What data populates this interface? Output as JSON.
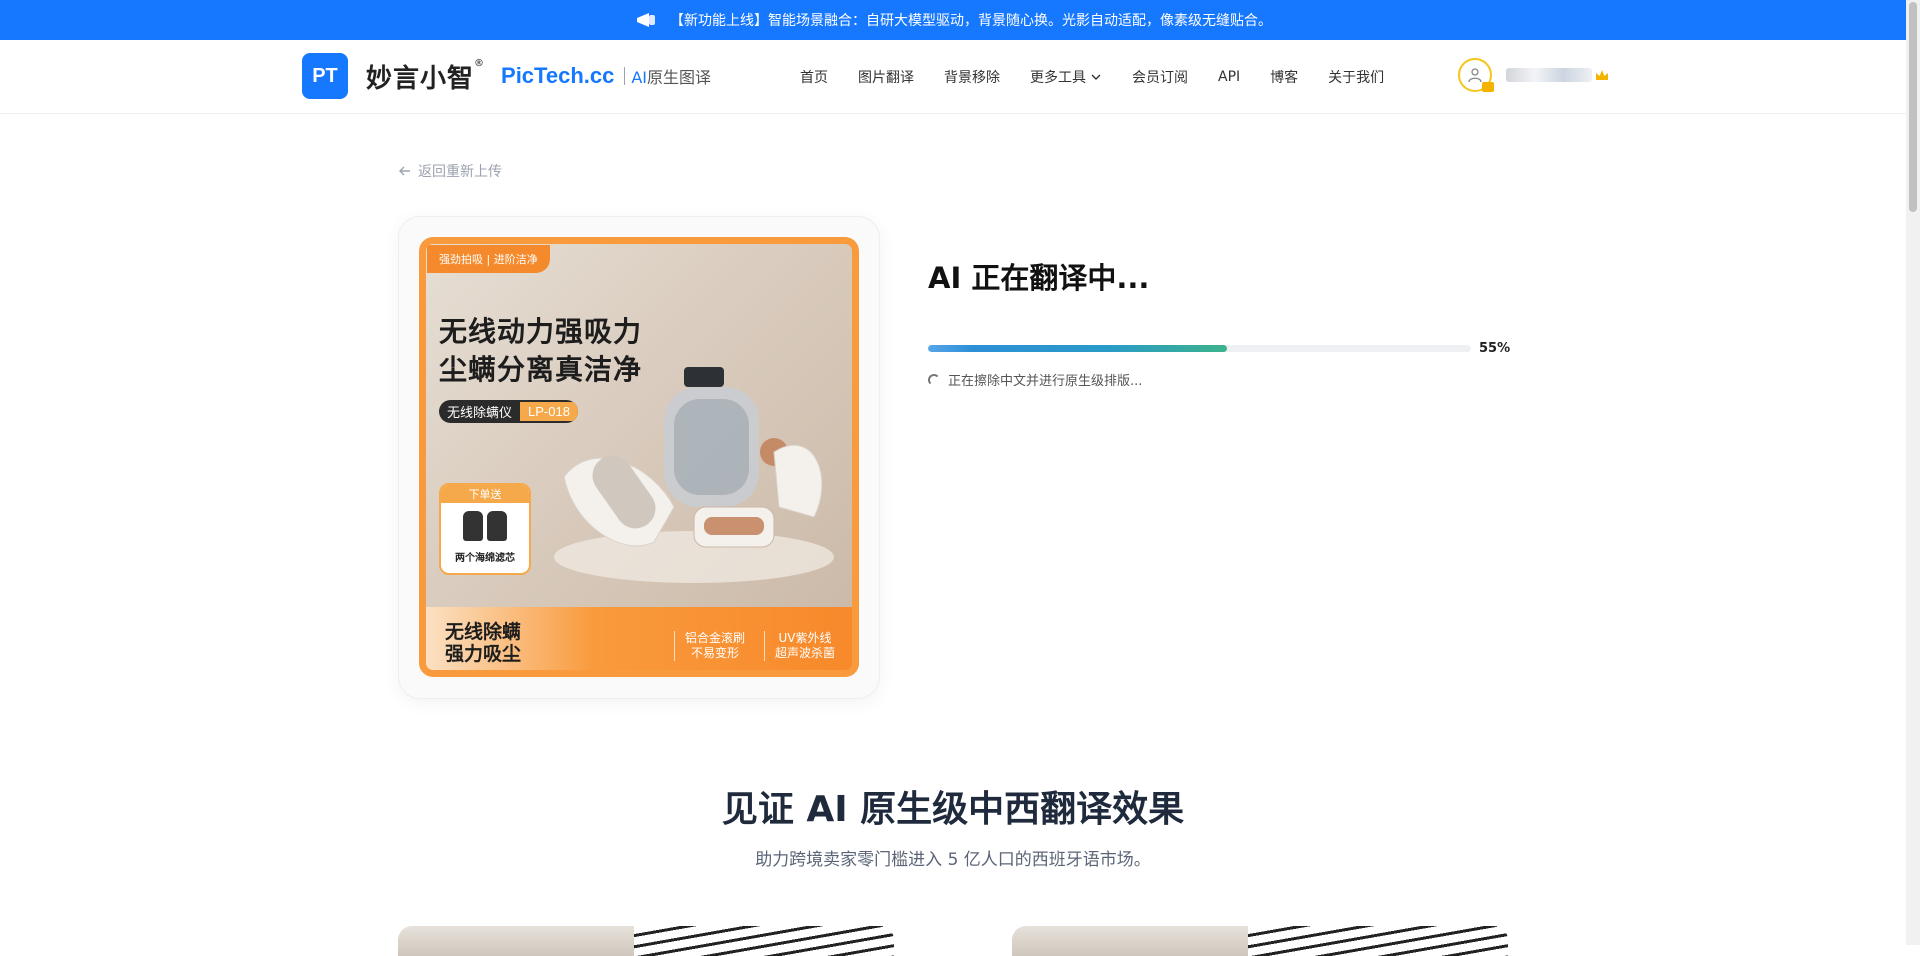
{
  "announcement": "【新功能上线】智能场景融合：自研大模型驱动，背景随心换。光影自动适配，像素级无缝贴合。",
  "brand": {
    "mark": "PT",
    "name_cn": "妙言小智",
    "reg": "®",
    "name_en": "PicTech.cc",
    "tagline_ai": "AI",
    "tagline_rest": "原生图译"
  },
  "nav": {
    "items": [
      "首页",
      "图片翻译",
      "背景移除",
      "更多工具",
      "会员订阅",
      "API",
      "博客",
      "关于我们"
    ]
  },
  "back_link": "返回重新上传",
  "product_image": {
    "top_tag": "强劲拍吸 | 进阶洁净",
    "headline_1": "无线动力强吸力",
    "headline_2": "尘螨分离真洁净",
    "model_label": "无线除螨仪",
    "model_code": "LP-018",
    "gift_header": "下单送",
    "gift_caption": "两个海绵滤芯",
    "bottom_left_1": "无线除螨",
    "bottom_left_2": "强力吸尘",
    "feature_1_line1": "铝合金滚刷",
    "feature_1_line2": "不易变形",
    "feature_2_line1": "UV紫外线",
    "feature_2_line2": "超声波杀菌"
  },
  "status": {
    "title": "AI 正在翻译中...",
    "progress": 55,
    "progress_label": "55%",
    "message": "正在擦除中文并进行原生级排版..."
  },
  "section": {
    "title": "见证 AI 原生级中西翻译效果",
    "subtitle": "助力跨境卖家零门槛进入 5 亿人口的西班牙语市场。"
  },
  "colors": {
    "brand_blue": "#1677ff",
    "accent_orange": "#f99a3c",
    "progress_green": "#3db28c"
  }
}
